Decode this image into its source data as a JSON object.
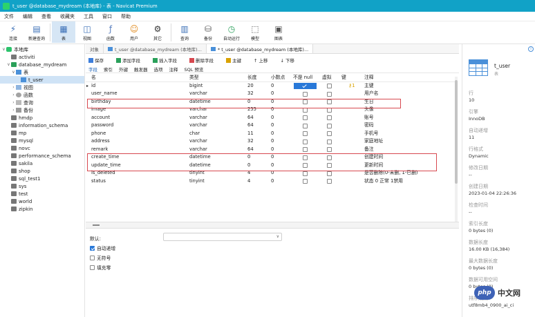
{
  "window": {
    "title": "t_user @database_mydream (本地库) - 表 - Navicat Premium"
  },
  "menu": [
    "文件",
    "编辑",
    "查看",
    "收藏夹",
    "工具",
    "窗口",
    "帮助"
  ],
  "toolbar": [
    {
      "key": "connect",
      "label": "连接",
      "icon": "plug-icon"
    },
    {
      "key": "new_query",
      "label": "新建查询",
      "icon": "new-query-icon"
    },
    {
      "key": "table",
      "label": "表",
      "icon": "table-icon",
      "active": true
    },
    {
      "key": "view",
      "label": "视图",
      "icon": "view-icon"
    },
    {
      "key": "function",
      "label": "函数",
      "icon": "function-icon"
    },
    {
      "key": "user",
      "label": "用户",
      "icon": "user-icon"
    },
    {
      "key": "other",
      "label": "其它",
      "icon": "other-icon"
    },
    {
      "key": "query",
      "label": "查询",
      "icon": "query-icon"
    },
    {
      "key": "backup",
      "label": "备份",
      "icon": "backup-icon"
    },
    {
      "key": "auto_run",
      "label": "自动运行",
      "icon": "auto-run-icon"
    },
    {
      "key": "model",
      "label": "模型",
      "icon": "model-icon"
    },
    {
      "key": "chart",
      "label": "图表",
      "icon": "chart-icon"
    }
  ],
  "tree": {
    "connection": "本地库",
    "items": [
      {
        "label": "activiti",
        "type": "db",
        "indent": 1
      },
      {
        "label": "database_mydream",
        "type": "dbg",
        "indent": 1,
        "expanded": true
      },
      {
        "label": "表",
        "type": "tbl",
        "indent": 2,
        "expanded": true
      },
      {
        "label": "t_user",
        "type": "tbl",
        "indent": 3,
        "selected": true
      },
      {
        "label": "视图",
        "type": "view",
        "indent": 2
      },
      {
        "label": "函数",
        "type": "fn",
        "indent": 2
      },
      {
        "label": "查询",
        "type": "qry",
        "indent": 2
      },
      {
        "label": "备份",
        "type": "bak",
        "indent": 2
      },
      {
        "label": "hmdp",
        "type": "db",
        "indent": 1
      },
      {
        "label": "information_schema",
        "type": "db",
        "indent": 1
      },
      {
        "label": "mp",
        "type": "db",
        "indent": 1
      },
      {
        "label": "mysql",
        "type": "db",
        "indent": 1
      },
      {
        "label": "novc",
        "type": "db",
        "indent": 1
      },
      {
        "label": "performance_schema",
        "type": "db",
        "indent": 1
      },
      {
        "label": "sakila",
        "type": "db",
        "indent": 1
      },
      {
        "label": "shop",
        "type": "db",
        "indent": 1
      },
      {
        "label": "sql_test1",
        "type": "db",
        "indent": 1
      },
      {
        "label": "sys",
        "type": "db",
        "indent": 1
      },
      {
        "label": "test",
        "type": "db",
        "indent": 1
      },
      {
        "label": "world",
        "type": "db",
        "indent": 1
      },
      {
        "label": "zipkin",
        "type": "db",
        "indent": 1
      }
    ]
  },
  "tabs": [
    {
      "label": "对象",
      "active": false
    },
    {
      "label": "t_user @database_mydream (本地库)...",
      "active": false
    },
    {
      "label": "* t_user @database_mydream (本地库)...",
      "active": true
    }
  ],
  "editor_toolbar": [
    {
      "label": "保存",
      "icon": "save-icon",
      "color": "#3d7edb"
    },
    {
      "label": "添加字段",
      "icon": "add-field-icon",
      "color": "#2aa05a"
    },
    {
      "label": "插入字段",
      "icon": "insert-field-icon",
      "color": "#2aa05a"
    },
    {
      "label": "删除字段",
      "icon": "delete-field-icon",
      "color": "#d7484f"
    },
    {
      "label": "主键",
      "icon": "key-icon",
      "color": "#d9a200"
    },
    {
      "label": "↑ 上移",
      "icon": "",
      "color": ""
    },
    {
      "label": "↓ 下移",
      "icon": "",
      "color": ""
    }
  ],
  "subtabs": [
    "字段",
    "索引",
    "外键",
    "触发器",
    "选项",
    "注释",
    "SQL 预览"
  ],
  "grid": {
    "headers": {
      "name": "名",
      "type": "类型",
      "len": "长度",
      "dec": "小数点",
      "nn": "不是 null",
      "virt": "虚拟",
      "key": "键",
      "cmt": "注释"
    },
    "rows": [
      {
        "name": "id",
        "type": "bigint",
        "len": "20",
        "dec": "0",
        "nn": true,
        "pk": true,
        "cmt": "主键",
        "current": true
      },
      {
        "name": "user_name",
        "type": "varchar",
        "len": "32",
        "dec": "0",
        "nn": false,
        "cmt": "用户名"
      },
      {
        "name": "birthday",
        "type": "datetime",
        "len": "0",
        "dec": "0",
        "nn": false,
        "cmt": "生日"
      },
      {
        "name": "image",
        "type": "varchar",
        "len": "255",
        "dec": "0",
        "nn": false,
        "cmt": "头像"
      },
      {
        "name": "account",
        "type": "varchar",
        "len": "64",
        "dec": "0",
        "nn": false,
        "cmt": "账号"
      },
      {
        "name": "password",
        "type": "varchar",
        "len": "64",
        "dec": "0",
        "nn": false,
        "cmt": "密码"
      },
      {
        "name": "phone",
        "type": "char",
        "len": "11",
        "dec": "0",
        "nn": false,
        "cmt": "手机号"
      },
      {
        "name": "address",
        "type": "varchar",
        "len": "32",
        "dec": "0",
        "nn": false,
        "cmt": "家庭地址"
      },
      {
        "name": "remark",
        "type": "varchar",
        "len": "64",
        "dec": "0",
        "nn": false,
        "cmt": "备注"
      },
      {
        "name": "create_time",
        "type": "datetime",
        "len": "0",
        "dec": "0",
        "nn": false,
        "cmt": "创建时间"
      },
      {
        "name": "update_time",
        "type": "datetime",
        "len": "0",
        "dec": "0",
        "nn": false,
        "cmt": "更新时间"
      },
      {
        "name": "is_deleted",
        "type": "tinyint",
        "len": "4",
        "dec": "0",
        "nn": false,
        "cmt": "是否删除(0-未删, 1-已删)"
      },
      {
        "name": "status",
        "type": "tinyint",
        "len": "4",
        "dec": "0",
        "nn": false,
        "cmt": "状态 0 正常 1禁用"
      }
    ]
  },
  "props": {
    "default_label": "默认:",
    "default_value": "",
    "options": [
      {
        "label": "自动递增",
        "checked": true
      },
      {
        "label": "无符号",
        "checked": false
      },
      {
        "label": "填充零",
        "checked": false
      }
    ]
  },
  "info": {
    "title": "t_user",
    "subtitle": "表",
    "fields": [
      {
        "label": "行",
        "value": "10"
      },
      {
        "label": "引擎",
        "value": "InnoDB"
      },
      {
        "label": "自动递增",
        "value": "11"
      },
      {
        "label": "行格式",
        "value": "Dynamic"
      },
      {
        "label": "修改日期",
        "value": "--"
      },
      {
        "label": "创建日期",
        "value": "2023-01-04 22:26:36"
      },
      {
        "label": "检查时间",
        "value": "--"
      },
      {
        "label": "索引长度",
        "value": "0 bytes (0)"
      },
      {
        "label": "数据长度",
        "value": "16.00 KB (16,384)"
      },
      {
        "label": "最大数据长度",
        "value": "0 bytes (0)"
      },
      {
        "label": "数据可用空间",
        "value": "0 bytes (0)"
      },
      {
        "label": "排序规则",
        "value": "utf8mb4_0900_ai_ci"
      }
    ]
  },
  "watermark": {
    "logo": "php",
    "text": "中文网"
  }
}
